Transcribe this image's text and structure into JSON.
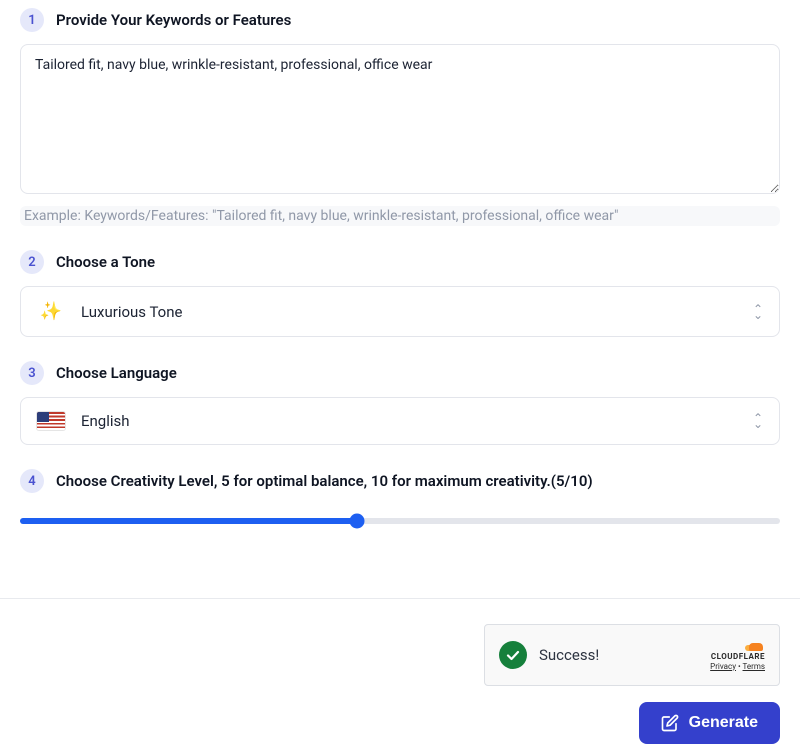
{
  "step1": {
    "number": "1",
    "title": "Provide Your Keywords or Features",
    "value": "Tailored fit, navy blue, wrinkle-resistant, professional, office wear",
    "example": "Example:  Keywords/Features: \"Tailored fit, navy blue, wrinkle-resistant, professional, office wear\""
  },
  "step2": {
    "number": "2",
    "title": "Choose a Tone",
    "icon_name": "sparkle-icon",
    "icon_glyph": "✨",
    "selected": "Luxurious Tone"
  },
  "step3": {
    "number": "3",
    "title": "Choose Language",
    "icon_name": "flag-us-icon",
    "selected": "English"
  },
  "step4": {
    "number": "4",
    "title": "Choose Creativity Level, 5 for optimal balance, 10 for maximum creativity.(5/10)",
    "value": 5,
    "min": 1,
    "max": 10
  },
  "captcha": {
    "status": "Success!",
    "brand": "CLOUDFLARE",
    "privacy": "Privacy",
    "terms": "Terms"
  },
  "actions": {
    "generate": "Generate"
  }
}
